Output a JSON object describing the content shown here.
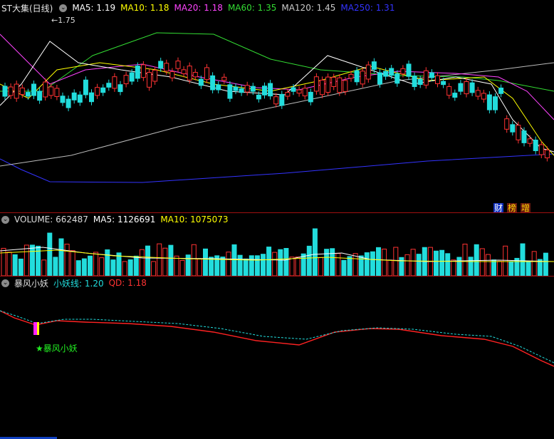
{
  "main_chart": {
    "title": "ST大集(日线)",
    "ma_items": [
      {
        "label": "MA5: 1.19",
        "color": "#ffffff"
      },
      {
        "label": "MA10: 1.18",
        "color": "#ffff00"
      },
      {
        "label": "MA20: 1.18",
        "color": "#ff44ff"
      },
      {
        "label": "MA60: 1.35",
        "color": "#33dd33"
      },
      {
        "label": "MA120: 1.45",
        "color": "#cccccc"
      },
      {
        "label": "MA250: 1.31",
        "color": "#3333ff"
      }
    ],
    "high_marker": "1.75",
    "badges": [
      {
        "label": "财",
        "color": "#ffffff",
        "bg": "#1030c0"
      },
      {
        "label": "榜",
        "color": "#ffd700",
        "bg": "#6a1a10"
      },
      {
        "label": "增",
        "color": "#ffd700",
        "bg": "#6a1a10"
      }
    ]
  },
  "volume_panel": {
    "title": "VOLUME: 662487",
    "ma5": "MA5: 1126691",
    "ma10": "MA10: 1075073"
  },
  "indicator_panel": {
    "title": "暴风小妖",
    "line1": "小妖线: 1.20",
    "line2": "QD: 1.18",
    "signal_label": "★暴风小妖"
  }
}
